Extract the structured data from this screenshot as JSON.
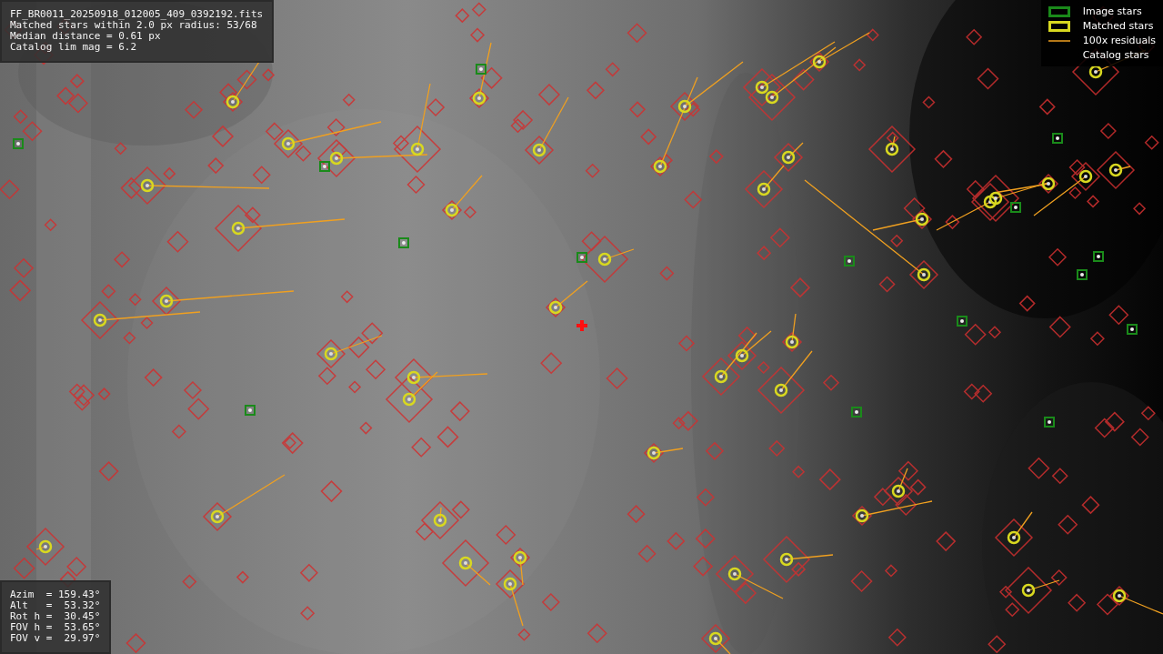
{
  "info_panel": {
    "lines": [
      "FF_BR0011_20250918_012005_409_0392192.fits",
      "Matched stars within 2.0 px radius: 53/68",
      "Median distance = 0.61 px",
      "Catalog lim mag = 6.2"
    ]
  },
  "legend": {
    "items": [
      {
        "label": "Image stars"
      },
      {
        "kind": "matched",
        "label": "Matched stars"
      },
      {
        "kind": "residual",
        "label": "100x residuals"
      },
      {
        "kind": "catalog",
        "label": "Catalog stars"
      }
    ]
  },
  "pointing_panel": {
    "lines": [
      "Azim  = 159.43°",
      "Alt   =  53.32°",
      "Rot h =  30.45°",
      "FOV h =  53.65°",
      "FOV v =  29.97°"
    ]
  }
}
